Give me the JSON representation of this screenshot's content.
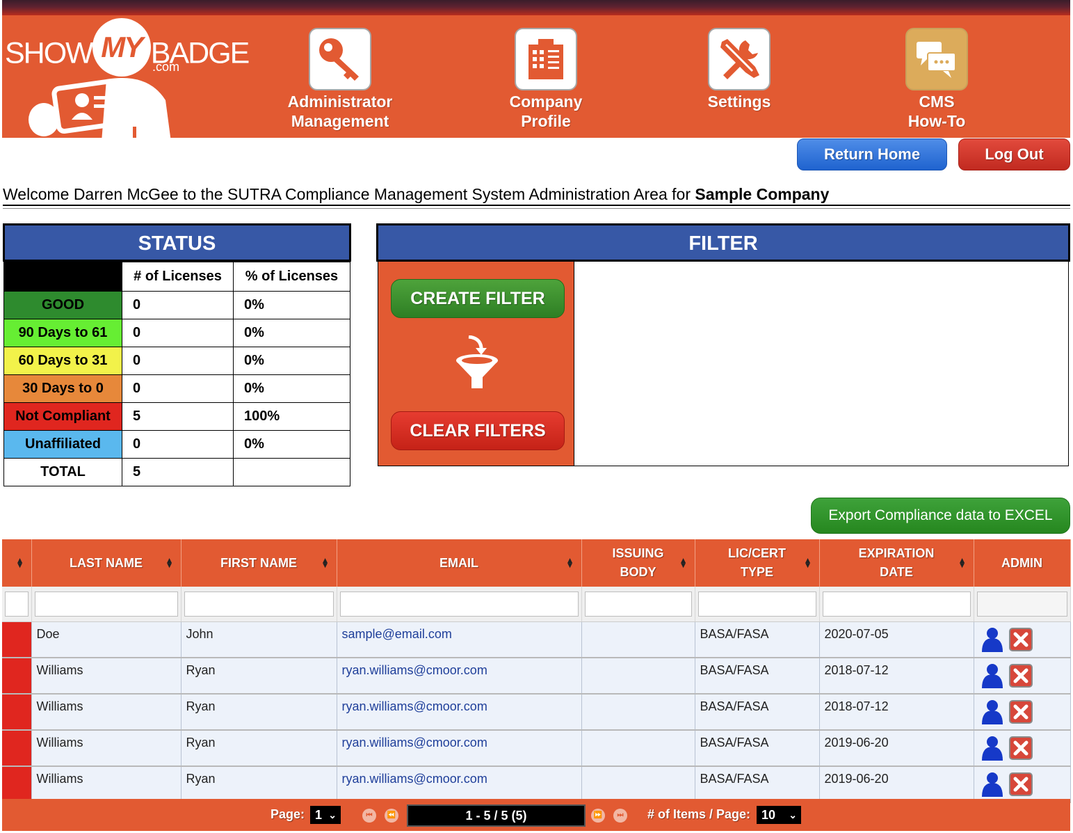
{
  "logo": {
    "show": "SHOW",
    "my": "MY",
    "badge": "BADGE",
    "com": ".com"
  },
  "nav": [
    {
      "line1": "Administrator",
      "line2": "Management",
      "icon": "key-icon"
    },
    {
      "line1": "Company",
      "line2": "Profile",
      "icon": "building-icon"
    },
    {
      "line1": "Settings",
      "line2": "",
      "icon": "tools-icon"
    },
    {
      "line1": "CMS",
      "line2": "How-To",
      "icon": "chat-icon"
    }
  ],
  "buttons": {
    "return_home": "Return Home",
    "log_out": "Log Out",
    "export": "Export Compliance data to EXCEL",
    "create_filter": "CREATE FILTER",
    "clear_filters": "CLEAR FILTERS"
  },
  "welcome": {
    "text": "Welcome Darren McGee to the SUTRA Compliance Management System Administration Area for ",
    "company": "Sample Company"
  },
  "status": {
    "title": "STATUS",
    "col_count": "# of Licenses",
    "col_pct": "% of Licenses",
    "rows": [
      {
        "label": "GOOD",
        "count": "0",
        "pct": "0%",
        "color": "#2e8b2e",
        "text_color": "#000000"
      },
      {
        "label": "90 Days to 61",
        "count": "0",
        "pct": "0%",
        "color": "#66ee33",
        "text_color": "#000000"
      },
      {
        "label": "60 Days to 31",
        "count": "0",
        "pct": "0%",
        "color": "#f2f24a",
        "text_color": "#000000"
      },
      {
        "label": "30 Days to 0",
        "count": "0",
        "pct": "0%",
        "color": "#e7883a",
        "text_color": "#000000"
      },
      {
        "label": "Not Compliant",
        "count": "5",
        "pct": "100%",
        "color": "#e0261f",
        "text_color": "#000000"
      },
      {
        "label": "Unaffiliated",
        "count": "0",
        "pct": "0%",
        "color": "#5ab8ee",
        "text_color": "#000000"
      },
      {
        "label": "TOTAL",
        "count": "5",
        "pct": "",
        "color": "#ffffff",
        "text_color": "#000000"
      }
    ]
  },
  "filter": {
    "title": "FILTER"
  },
  "table": {
    "headers": [
      "",
      "LAST NAME",
      "FIRST NAME",
      "EMAIL",
      "ISSUING BODY",
      "LIC/CERT TYPE",
      "EXPIRATION DATE",
      "ADMIN"
    ],
    "header_lines": [
      [
        "",
        ""
      ],
      [
        "LAST NAME",
        ""
      ],
      [
        "FIRST NAME",
        ""
      ],
      [
        "EMAIL",
        ""
      ],
      [
        "ISSUING",
        "BODY"
      ],
      [
        "LIC/CERT",
        "TYPE"
      ],
      [
        "EXPIRATION",
        "DATE"
      ],
      [
        "ADMIN",
        ""
      ]
    ],
    "rows": [
      {
        "last": "Doe",
        "first": "John",
        "email": "sample@email.com",
        "body": "",
        "type": "BASA/FASA",
        "exp": "2020-07-05"
      },
      {
        "last": "Williams",
        "first": "Ryan",
        "email": "ryan.williams@cmoor.com",
        "body": "",
        "type": "BASA/FASA",
        "exp": "2018-07-12"
      },
      {
        "last": "Williams",
        "first": "Ryan",
        "email": "ryan.williams@cmoor.com",
        "body": "",
        "type": "BASA/FASA",
        "exp": "2018-07-12"
      },
      {
        "last": "Williams",
        "first": "Ryan",
        "email": "ryan.williams@cmoor.com",
        "body": "",
        "type": "BASA/FASA",
        "exp": "2019-06-20"
      },
      {
        "last": "Williams",
        "first": "Ryan",
        "email": "ryan.williams@cmoor.com",
        "body": "",
        "type": "BASA/FASA",
        "exp": "2019-06-20"
      }
    ]
  },
  "pager": {
    "page_label": "Page:",
    "page": "1",
    "range": "1 - 5 / 5 (5)",
    "items_label": "# of Items / Page:",
    "items": "10"
  },
  "colors": {
    "brand": "#e25a32",
    "panel_blue": "#3758a6",
    "row_bg": "#edf2fa",
    "not_compliant": "#e0261f"
  }
}
